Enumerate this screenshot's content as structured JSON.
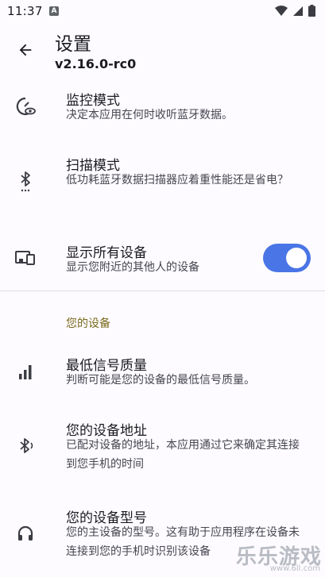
{
  "status_bar": {
    "time": "11:37",
    "app_icon_letter": "A",
    "icons": [
      "wifi-icon",
      "cell-signal-icon",
      "battery-icon"
    ]
  },
  "app_bar": {
    "back_icon": "arrow-back-icon",
    "title": "设置",
    "version": "v2.16.0-rc0"
  },
  "preferences": [
    {
      "icon": "monitor-eye-icon",
      "title": "监控模式",
      "summary": "决定本应用在何时收听蓝牙数据。"
    },
    {
      "icon": "bluetooth-searching-icon",
      "title": "扫描模式",
      "summary": "低功耗蓝牙数据扫描器应着重性能还是省电？"
    },
    {
      "icon": "devices-icon",
      "title": "显示所有设备",
      "summary": "显示您附近的其他人的设备",
      "switch_on": true
    }
  ],
  "category": {
    "label": "您的设备"
  },
  "device_preferences": [
    {
      "icon": "signal-bars-icon",
      "title": "最低信号质量",
      "summary": "判断可能是您的设备的最低信号质量。"
    },
    {
      "icon": "bluetooth-connected-icon",
      "title": "您的设备地址",
      "summary": "已配对设备的地址，本应用通过它来确定其连接到您手机的时间"
    },
    {
      "icon": "headphones-icon",
      "title": "您的设备型号",
      "summary": "您的主设备的型号。这有助于应用程序在设备未连接到您的手机时识别该设备"
    }
  ],
  "watermark": {
    "text": "乐乐游戏",
    "url": "www.6ll.com"
  },
  "colors": {
    "accent": "#4a75e6",
    "category": "#7a6a1c",
    "background": "#fdfbff"
  }
}
